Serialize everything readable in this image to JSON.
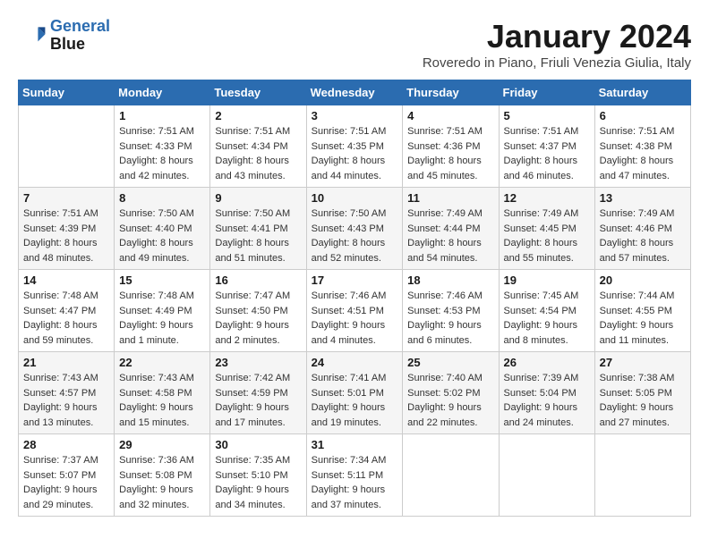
{
  "logo": {
    "line1": "General",
    "line2": "Blue"
  },
  "title": "January 2024",
  "location": "Roveredo in Piano, Friuli Venezia Giulia, Italy",
  "days_of_week": [
    "Sunday",
    "Monday",
    "Tuesday",
    "Wednesday",
    "Thursday",
    "Friday",
    "Saturday"
  ],
  "weeks": [
    [
      {
        "day": "",
        "info": ""
      },
      {
        "day": "1",
        "info": "Sunrise: 7:51 AM\nSunset: 4:33 PM\nDaylight: 8 hours\nand 42 minutes."
      },
      {
        "day": "2",
        "info": "Sunrise: 7:51 AM\nSunset: 4:34 PM\nDaylight: 8 hours\nand 43 minutes."
      },
      {
        "day": "3",
        "info": "Sunrise: 7:51 AM\nSunset: 4:35 PM\nDaylight: 8 hours\nand 44 minutes."
      },
      {
        "day": "4",
        "info": "Sunrise: 7:51 AM\nSunset: 4:36 PM\nDaylight: 8 hours\nand 45 minutes."
      },
      {
        "day": "5",
        "info": "Sunrise: 7:51 AM\nSunset: 4:37 PM\nDaylight: 8 hours\nand 46 minutes."
      },
      {
        "day": "6",
        "info": "Sunrise: 7:51 AM\nSunset: 4:38 PM\nDaylight: 8 hours\nand 47 minutes."
      }
    ],
    [
      {
        "day": "7",
        "info": "Sunrise: 7:51 AM\nSunset: 4:39 PM\nDaylight: 8 hours\nand 48 minutes."
      },
      {
        "day": "8",
        "info": "Sunrise: 7:50 AM\nSunset: 4:40 PM\nDaylight: 8 hours\nand 49 minutes."
      },
      {
        "day": "9",
        "info": "Sunrise: 7:50 AM\nSunset: 4:41 PM\nDaylight: 8 hours\nand 51 minutes."
      },
      {
        "day": "10",
        "info": "Sunrise: 7:50 AM\nSunset: 4:43 PM\nDaylight: 8 hours\nand 52 minutes."
      },
      {
        "day": "11",
        "info": "Sunrise: 7:49 AM\nSunset: 4:44 PM\nDaylight: 8 hours\nand 54 minutes."
      },
      {
        "day": "12",
        "info": "Sunrise: 7:49 AM\nSunset: 4:45 PM\nDaylight: 8 hours\nand 55 minutes."
      },
      {
        "day": "13",
        "info": "Sunrise: 7:49 AM\nSunset: 4:46 PM\nDaylight: 8 hours\nand 57 minutes."
      }
    ],
    [
      {
        "day": "14",
        "info": "Sunrise: 7:48 AM\nSunset: 4:47 PM\nDaylight: 8 hours\nand 59 minutes."
      },
      {
        "day": "15",
        "info": "Sunrise: 7:48 AM\nSunset: 4:49 PM\nDaylight: 9 hours\nand 1 minute."
      },
      {
        "day": "16",
        "info": "Sunrise: 7:47 AM\nSunset: 4:50 PM\nDaylight: 9 hours\nand 2 minutes."
      },
      {
        "day": "17",
        "info": "Sunrise: 7:46 AM\nSunset: 4:51 PM\nDaylight: 9 hours\nand 4 minutes."
      },
      {
        "day": "18",
        "info": "Sunrise: 7:46 AM\nSunset: 4:53 PM\nDaylight: 9 hours\nand 6 minutes."
      },
      {
        "day": "19",
        "info": "Sunrise: 7:45 AM\nSunset: 4:54 PM\nDaylight: 9 hours\nand 8 minutes."
      },
      {
        "day": "20",
        "info": "Sunrise: 7:44 AM\nSunset: 4:55 PM\nDaylight: 9 hours\nand 11 minutes."
      }
    ],
    [
      {
        "day": "21",
        "info": "Sunrise: 7:43 AM\nSunset: 4:57 PM\nDaylight: 9 hours\nand 13 minutes."
      },
      {
        "day": "22",
        "info": "Sunrise: 7:43 AM\nSunset: 4:58 PM\nDaylight: 9 hours\nand 15 minutes."
      },
      {
        "day": "23",
        "info": "Sunrise: 7:42 AM\nSunset: 4:59 PM\nDaylight: 9 hours\nand 17 minutes."
      },
      {
        "day": "24",
        "info": "Sunrise: 7:41 AM\nSunset: 5:01 PM\nDaylight: 9 hours\nand 19 minutes."
      },
      {
        "day": "25",
        "info": "Sunrise: 7:40 AM\nSunset: 5:02 PM\nDaylight: 9 hours\nand 22 minutes."
      },
      {
        "day": "26",
        "info": "Sunrise: 7:39 AM\nSunset: 5:04 PM\nDaylight: 9 hours\nand 24 minutes."
      },
      {
        "day": "27",
        "info": "Sunrise: 7:38 AM\nSunset: 5:05 PM\nDaylight: 9 hours\nand 27 minutes."
      }
    ],
    [
      {
        "day": "28",
        "info": "Sunrise: 7:37 AM\nSunset: 5:07 PM\nDaylight: 9 hours\nand 29 minutes."
      },
      {
        "day": "29",
        "info": "Sunrise: 7:36 AM\nSunset: 5:08 PM\nDaylight: 9 hours\nand 32 minutes."
      },
      {
        "day": "30",
        "info": "Sunrise: 7:35 AM\nSunset: 5:10 PM\nDaylight: 9 hours\nand 34 minutes."
      },
      {
        "day": "31",
        "info": "Sunrise: 7:34 AM\nSunset: 5:11 PM\nDaylight: 9 hours\nand 37 minutes."
      },
      {
        "day": "",
        "info": ""
      },
      {
        "day": "",
        "info": ""
      },
      {
        "day": "",
        "info": ""
      }
    ]
  ]
}
